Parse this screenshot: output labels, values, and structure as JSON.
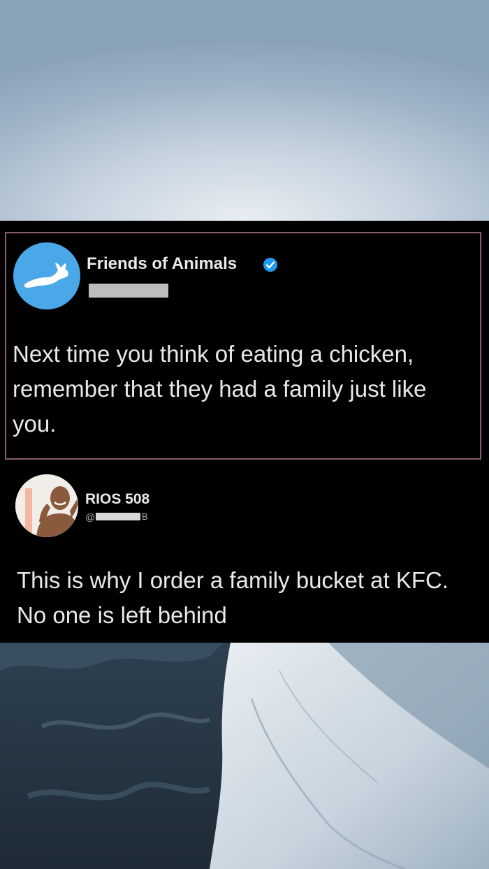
{
  "colors": {
    "tweet_border": "#8a5a74",
    "avatar_foa_bg": "#4aa7e8",
    "verified_badge": "#1d9bf0",
    "text_primary": "#e7e9ea",
    "text_secondary": "#a7acb0"
  },
  "tweet_original": {
    "author_name": "Friends of Animals",
    "verified": true,
    "avatar_icon": "hare-icon",
    "text": "Next time you think of eating a chicken, remember that they had a family  just like you."
  },
  "tweet_reply": {
    "author_name": "RIOS 508",
    "handle_prefix": "@",
    "handle_suffix": "B",
    "avatar_icon": "person-avatar",
    "text": "This is why I order a family bucket at KFC. No one is left behind"
  }
}
